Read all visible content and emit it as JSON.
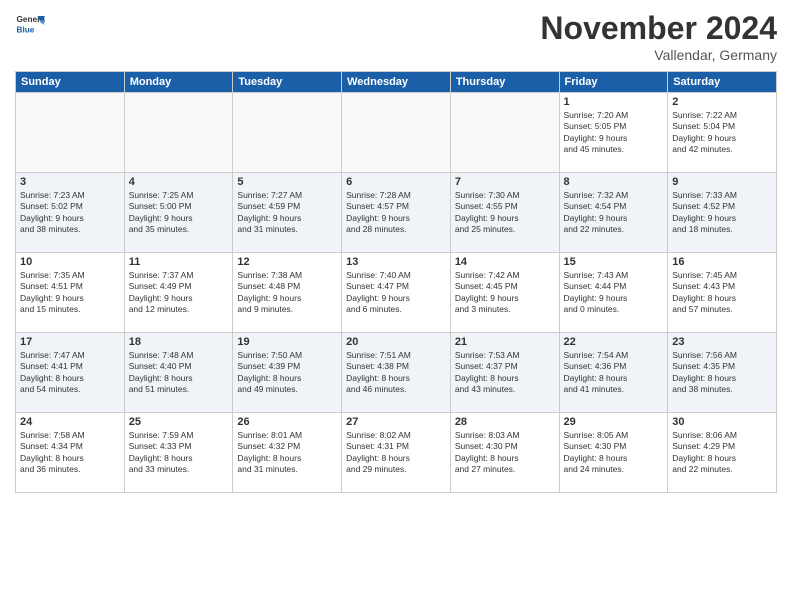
{
  "header": {
    "logo_line1": "General",
    "logo_line2": "Blue",
    "month_title": "November 2024",
    "location": "Vallendar, Germany"
  },
  "weekdays": [
    "Sunday",
    "Monday",
    "Tuesday",
    "Wednesday",
    "Thursday",
    "Friday",
    "Saturday"
  ],
  "weeks": [
    {
      "shaded": false,
      "days": [
        {
          "day": "",
          "info": ""
        },
        {
          "day": "",
          "info": ""
        },
        {
          "day": "",
          "info": ""
        },
        {
          "day": "",
          "info": ""
        },
        {
          "day": "",
          "info": ""
        },
        {
          "day": "1",
          "info": "Sunrise: 7:20 AM\nSunset: 5:05 PM\nDaylight: 9 hours\nand 45 minutes."
        },
        {
          "day": "2",
          "info": "Sunrise: 7:22 AM\nSunset: 5:04 PM\nDaylight: 9 hours\nand 42 minutes."
        }
      ]
    },
    {
      "shaded": true,
      "days": [
        {
          "day": "3",
          "info": "Sunrise: 7:23 AM\nSunset: 5:02 PM\nDaylight: 9 hours\nand 38 minutes."
        },
        {
          "day": "4",
          "info": "Sunrise: 7:25 AM\nSunset: 5:00 PM\nDaylight: 9 hours\nand 35 minutes."
        },
        {
          "day": "5",
          "info": "Sunrise: 7:27 AM\nSunset: 4:59 PM\nDaylight: 9 hours\nand 31 minutes."
        },
        {
          "day": "6",
          "info": "Sunrise: 7:28 AM\nSunset: 4:57 PM\nDaylight: 9 hours\nand 28 minutes."
        },
        {
          "day": "7",
          "info": "Sunrise: 7:30 AM\nSunset: 4:55 PM\nDaylight: 9 hours\nand 25 minutes."
        },
        {
          "day": "8",
          "info": "Sunrise: 7:32 AM\nSunset: 4:54 PM\nDaylight: 9 hours\nand 22 minutes."
        },
        {
          "day": "9",
          "info": "Sunrise: 7:33 AM\nSunset: 4:52 PM\nDaylight: 9 hours\nand 18 minutes."
        }
      ]
    },
    {
      "shaded": false,
      "days": [
        {
          "day": "10",
          "info": "Sunrise: 7:35 AM\nSunset: 4:51 PM\nDaylight: 9 hours\nand 15 minutes."
        },
        {
          "day": "11",
          "info": "Sunrise: 7:37 AM\nSunset: 4:49 PM\nDaylight: 9 hours\nand 12 minutes."
        },
        {
          "day": "12",
          "info": "Sunrise: 7:38 AM\nSunset: 4:48 PM\nDaylight: 9 hours\nand 9 minutes."
        },
        {
          "day": "13",
          "info": "Sunrise: 7:40 AM\nSunset: 4:47 PM\nDaylight: 9 hours\nand 6 minutes."
        },
        {
          "day": "14",
          "info": "Sunrise: 7:42 AM\nSunset: 4:45 PM\nDaylight: 9 hours\nand 3 minutes."
        },
        {
          "day": "15",
          "info": "Sunrise: 7:43 AM\nSunset: 4:44 PM\nDaylight: 9 hours\nand 0 minutes."
        },
        {
          "day": "16",
          "info": "Sunrise: 7:45 AM\nSunset: 4:43 PM\nDaylight: 8 hours\nand 57 minutes."
        }
      ]
    },
    {
      "shaded": true,
      "days": [
        {
          "day": "17",
          "info": "Sunrise: 7:47 AM\nSunset: 4:41 PM\nDaylight: 8 hours\nand 54 minutes."
        },
        {
          "day": "18",
          "info": "Sunrise: 7:48 AM\nSunset: 4:40 PM\nDaylight: 8 hours\nand 51 minutes."
        },
        {
          "day": "19",
          "info": "Sunrise: 7:50 AM\nSunset: 4:39 PM\nDaylight: 8 hours\nand 49 minutes."
        },
        {
          "day": "20",
          "info": "Sunrise: 7:51 AM\nSunset: 4:38 PM\nDaylight: 8 hours\nand 46 minutes."
        },
        {
          "day": "21",
          "info": "Sunrise: 7:53 AM\nSunset: 4:37 PM\nDaylight: 8 hours\nand 43 minutes."
        },
        {
          "day": "22",
          "info": "Sunrise: 7:54 AM\nSunset: 4:36 PM\nDaylight: 8 hours\nand 41 minutes."
        },
        {
          "day": "23",
          "info": "Sunrise: 7:56 AM\nSunset: 4:35 PM\nDaylight: 8 hours\nand 38 minutes."
        }
      ]
    },
    {
      "shaded": false,
      "days": [
        {
          "day": "24",
          "info": "Sunrise: 7:58 AM\nSunset: 4:34 PM\nDaylight: 8 hours\nand 36 minutes."
        },
        {
          "day": "25",
          "info": "Sunrise: 7:59 AM\nSunset: 4:33 PM\nDaylight: 8 hours\nand 33 minutes."
        },
        {
          "day": "26",
          "info": "Sunrise: 8:01 AM\nSunset: 4:32 PM\nDaylight: 8 hours\nand 31 minutes."
        },
        {
          "day": "27",
          "info": "Sunrise: 8:02 AM\nSunset: 4:31 PM\nDaylight: 8 hours\nand 29 minutes."
        },
        {
          "day": "28",
          "info": "Sunrise: 8:03 AM\nSunset: 4:30 PM\nDaylight: 8 hours\nand 27 minutes."
        },
        {
          "day": "29",
          "info": "Sunrise: 8:05 AM\nSunset: 4:30 PM\nDaylight: 8 hours\nand 24 minutes."
        },
        {
          "day": "30",
          "info": "Sunrise: 8:06 AM\nSunset: 4:29 PM\nDaylight: 8 hours\nand 22 minutes."
        }
      ]
    }
  ]
}
